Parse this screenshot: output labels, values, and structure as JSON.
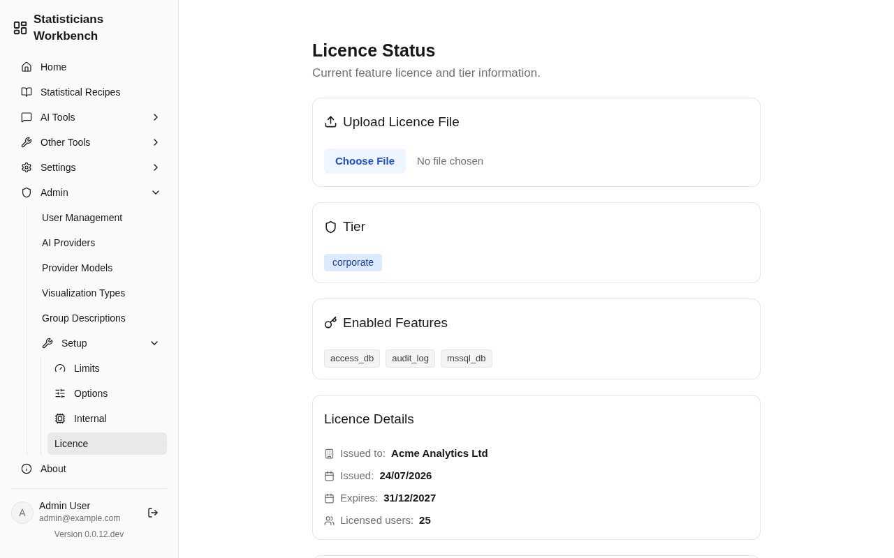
{
  "app": {
    "title": "Statisticians Workbench"
  },
  "nav": [
    {
      "label": "Home",
      "selected": false
    },
    {
      "label": "Statistical Recipes",
      "selected": false
    },
    {
      "label": "AI Tools",
      "selected": false,
      "expanded": false
    },
    {
      "label": "Other Tools",
      "selected": false,
      "expanded": false
    },
    {
      "label": "Settings",
      "selected": false,
      "expanded": false
    },
    {
      "label": "Admin",
      "selected": false,
      "expanded": true,
      "children": [
        {
          "label": "User Management",
          "selected": false
        },
        {
          "label": "AI Providers",
          "selected": false
        },
        {
          "label": "Provider Models",
          "selected": false
        },
        {
          "label": "Visualization Types",
          "selected": false
        },
        {
          "label": "Group Descriptions",
          "selected": false
        },
        {
          "label": "Setup",
          "selected": false,
          "expanded": true,
          "children": [
            {
              "label": "Limits",
              "selected": false
            },
            {
              "label": "Options",
              "selected": false
            },
            {
              "label": "Internal",
              "selected": false
            },
            {
              "label": "Licence",
              "selected": true
            }
          ]
        }
      ]
    },
    {
      "label": "About",
      "selected": false
    }
  ],
  "user": {
    "initial": "A",
    "name": "Admin User",
    "email": "admin@example.com"
  },
  "version": "Version 0.0.12.dev",
  "page": {
    "title": "Licence Status",
    "subtitle": "Current feature licence and tier information."
  },
  "upload": {
    "title": "Upload Licence File",
    "button": "Choose File",
    "status": "No file chosen"
  },
  "tier": {
    "title": "Tier",
    "value": "corporate"
  },
  "features": {
    "title": "Enabled Features",
    "items": [
      "access_db",
      "audit_log",
      "mssql_db"
    ]
  },
  "details": {
    "title": "Licence Details",
    "rows": [
      {
        "label": "Issued to:",
        "value": "Acme Analytics Ltd"
      },
      {
        "label": "Issued:",
        "value": "24/07/2026"
      },
      {
        "label": "Expires:",
        "value": "31/12/2027"
      },
      {
        "label": "Licensed users:",
        "value": "25"
      }
    ]
  }
}
